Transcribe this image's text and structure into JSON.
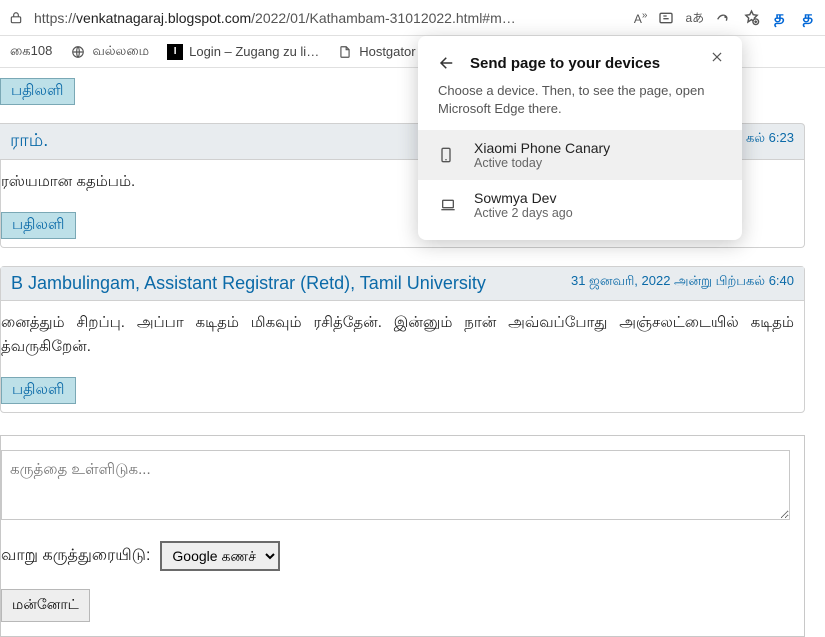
{
  "url": {
    "domain": "venkatnagaraj.blogspot.com",
    "path": "/2022/01/Kathambam-31012022.html#m",
    "prefix": "https://"
  },
  "toolbar": {
    "readaloud": "aあ"
  },
  "lang": {
    "a": "த",
    "b": "த"
  },
  "bookmarks": {
    "a": "கை108",
    "b": "வல்லமை",
    "c": "Login – Zugang zu li…",
    "d": "Hostgator"
  },
  "partial_reply": "பதிலளி",
  "c1": {
    "author": "ராம்.",
    "ts": "கல் 6:23",
    "body": "ரஸ்யமான கதம்பம்.",
    "reply": "பதிலளி"
  },
  "c2": {
    "author": "B Jambulingam, Assistant Registrar (Retd), Tamil University",
    "ts": "31 ஜனவரி, 2022 அன்று பிற்பகல் 6:40",
    "body": "னைத்தும் சிறப்பு. அப்பா கடிதம் மிகவும் ரசித்தேன். இன்னும் நான் அவ்வப்போது அஞ்சலட்டையில் கடிதம் த்வருகிறேன்.",
    "reply": "பதிலளி"
  },
  "form": {
    "placeholder": "கருத்தை உள்ளிடுக...",
    "label": "வாறு கருத்துரையிடு:",
    "select": "Google கணச்",
    "preview": "மன்னோட்"
  },
  "popup": {
    "title": "Send page to your devices",
    "desc": "Choose a device. Then, to see the page, open Microsoft Edge there.",
    "d1": {
      "name": "Xiaomi Phone Canary",
      "stat": "Active today"
    },
    "d2": {
      "name": "Sowmya Dev",
      "stat": "Active 2 days ago"
    }
  }
}
